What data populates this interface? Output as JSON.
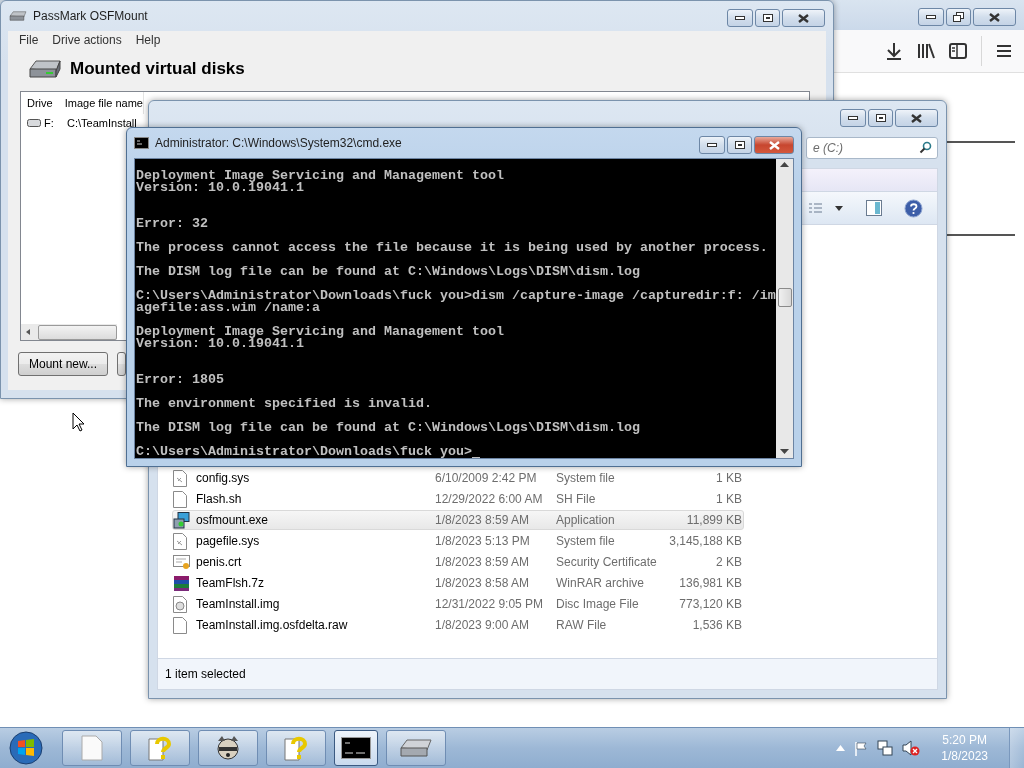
{
  "osfmount": {
    "title": "PassMark OSFMount",
    "menu": [
      "File",
      "Drive actions",
      "Help"
    ],
    "heading": "Mounted virtual disks",
    "columns": [
      "Drive",
      "Image file name"
    ],
    "rows": [
      {
        "drive": "F:",
        "image_file": "C:\\TeamInstall"
      }
    ],
    "buttons": [
      "Mount new..."
    ]
  },
  "explorer": {
    "search": {
      "placeholder": "e (C:)"
    },
    "files": [
      {
        "kind": "system",
        "name": "config.sys",
        "date": "6/10/2009 2:42 PM",
        "type": "System file",
        "size": "1 KB",
        "selected": false
      },
      {
        "kind": "text",
        "name": "Flash.sh",
        "date": "12/29/2022 6:00 AM",
        "type": "SH File",
        "size": "1 KB",
        "selected": false
      },
      {
        "kind": "app",
        "name": "osfmount.exe",
        "date": "1/8/2023 8:59 AM",
        "type": "Application",
        "size": "11,899 KB",
        "selected": true
      },
      {
        "kind": "system",
        "name": "pagefile.sys",
        "date": "1/8/2023 5:13 PM",
        "type": "System file",
        "size": "3,145,188 KB",
        "selected": false
      },
      {
        "kind": "cert",
        "name": "penis.crt",
        "date": "1/8/2023 8:59 AM",
        "type": "Security Certificate",
        "size": "2 KB",
        "selected": false
      },
      {
        "kind": "archive",
        "name": "TeamFlsh.7z",
        "date": "1/8/2023 8:58 AM",
        "type": "WinRAR archive",
        "size": "136,981 KB",
        "selected": false
      },
      {
        "kind": "disc",
        "name": "TeamInstall.img",
        "date": "12/31/2022 9:05 PM",
        "type": "Disc Image File",
        "size": "773,120 KB",
        "selected": false
      },
      {
        "kind": "text",
        "name": "TeamInstall.img.osfdelta.raw",
        "date": "1/8/2023 9:00 AM",
        "type": "RAW File",
        "size": "1,536 KB",
        "selected": false
      }
    ],
    "status_bar": "1 item selected"
  },
  "cmd": {
    "title": "Administrator: C:\\Windows\\System32\\cmd.exe",
    "lines": [
      {
        "kind": "text",
        "text": "Deployment Image Servicing and Management tool"
      },
      {
        "kind": "text",
        "text": "Version: 10.0.19041.1"
      },
      {
        "kind": "blank"
      },
      {
        "kind": "blank"
      },
      {
        "kind": "text",
        "text": "Error: 32"
      },
      {
        "kind": "blank"
      },
      {
        "kind": "text",
        "text": "The process cannot access the file because it is being used by another process."
      },
      {
        "kind": "blank"
      },
      {
        "kind": "text",
        "text": "The DISM log file can be found at C:\\Windows\\Logs\\DISM\\dism.log"
      },
      {
        "kind": "blank"
      },
      {
        "kind": "text",
        "text": "C:\\Users\\Administrator\\Downloads\\fuck you>dism /capture-image /capturedir:f: /im"
      },
      {
        "kind": "text",
        "text": "agefile:ass.wim /name:a"
      },
      {
        "kind": "blank"
      },
      {
        "kind": "text",
        "text": "Deployment Image Servicing and Management tool"
      },
      {
        "kind": "text",
        "text": "Version: 10.0.19041.1"
      },
      {
        "kind": "blank"
      },
      {
        "kind": "blank"
      },
      {
        "kind": "text",
        "text": "Error: 1805"
      },
      {
        "kind": "blank"
      },
      {
        "kind": "text",
        "text": "The environment specified is invalid."
      },
      {
        "kind": "blank"
      },
      {
        "kind": "text",
        "text": "The DISM log file can be found at C:\\Windows\\Logs\\DISM\\dism.log"
      },
      {
        "kind": "blank"
      },
      {
        "kind": "prompt",
        "text": "C:\\Users\\Administrator\\Downloads\\fuck you>"
      }
    ]
  },
  "taskbar": {
    "apps": [
      {
        "kind": "document",
        "selected": false
      },
      {
        "kind": "help",
        "selected": false
      },
      {
        "kind": "raccoon",
        "selected": false
      },
      {
        "kind": "help",
        "selected": false
      },
      {
        "kind": "console",
        "selected": true
      },
      {
        "kind": "drive",
        "selected": false
      }
    ],
    "clock": {
      "time": "5:20 PM",
      "date": "1/8/2023"
    }
  }
}
